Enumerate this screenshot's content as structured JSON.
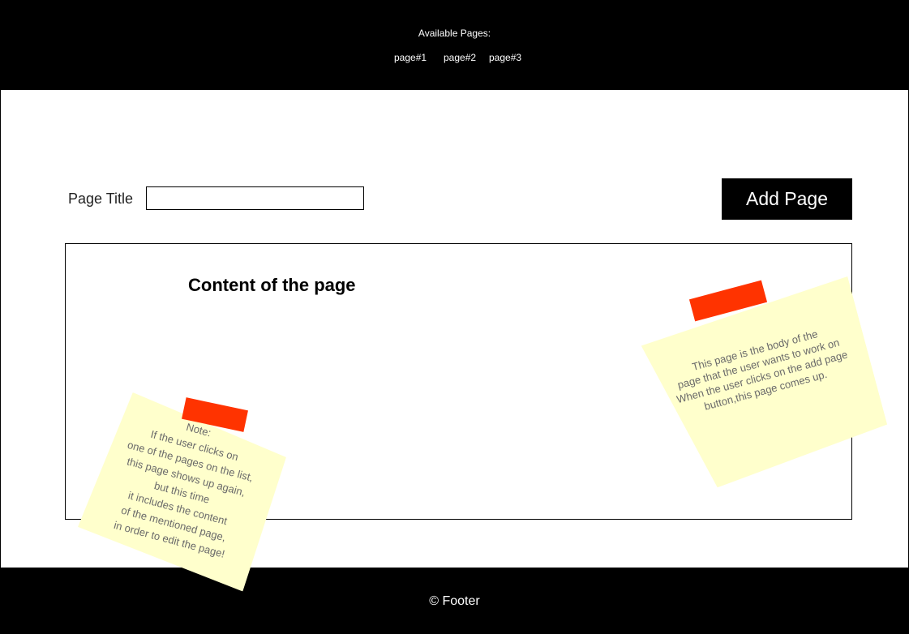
{
  "header": {
    "available_label": "Available Pages:",
    "pages": [
      "page#1",
      "page#2",
      "page#3"
    ]
  },
  "form": {
    "title_label": "Page Title",
    "title_value": "",
    "add_button_label": "Add Page"
  },
  "content": {
    "heading": "Content of the page"
  },
  "notes": {
    "right_text": "This page is the body of the\npage that the user wants to work on\nWhen the user clicks on the add page\nbutton,this page comes up.",
    "left_text": "Note:\nIf the user clicks on\none of the pages on the list,\nthis page shows up again,\nbut this time\nit includes the content\nof the mentioned page,\nin order to edit the page!"
  },
  "footer": {
    "text": "© Footer"
  },
  "colors": {
    "header_bg": "#000000",
    "footer_bg": "#000000",
    "note_bg": "#ffffcc",
    "tape": "#ff3300"
  }
}
